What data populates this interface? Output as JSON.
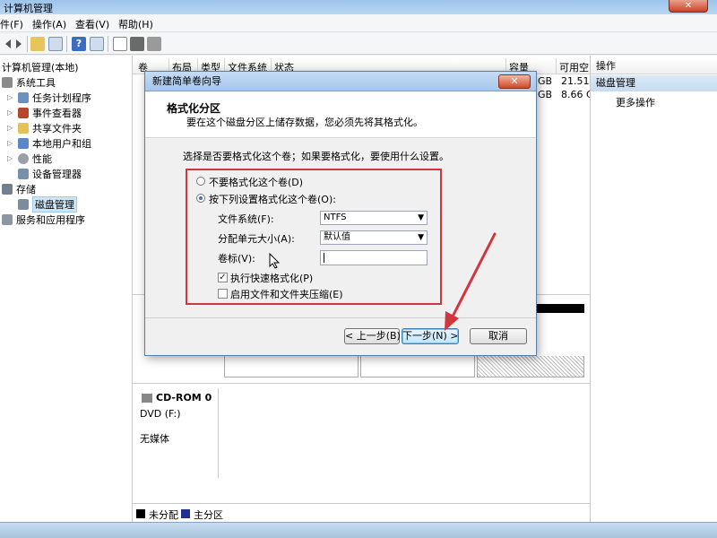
{
  "window": {
    "title": "计算机管理",
    "close_glyph": "✕"
  },
  "menu": [
    "件(F)",
    "操作(A)",
    "查看(V)",
    "帮助(H)"
  ],
  "tree": {
    "root": "计算机管理(本地)",
    "system_tools": "系统工具",
    "task_scheduler": "任务计划程序",
    "event_viewer": "事件查看器",
    "shared_folders": "共享文件夹",
    "local_users": "本地用户和组",
    "performance": "性能",
    "device_manager": "设备管理器",
    "storage": "存储",
    "disk_management": "磁盘管理",
    "services": "服务和应用程序"
  },
  "columns": {
    "volume": "卷",
    "layout": "布局",
    "type": "类型",
    "filesystem": "文件系统",
    "status": "状态",
    "capacity": "容量",
    "free": "可用空"
  },
  "volume_rows": [
    {
      "capacity": "GB",
      "free": "21.51"
    },
    {
      "capacity": "GB",
      "free": "8.66 C"
    }
  ],
  "cdrom": {
    "name": "CD-ROM 0",
    "drive": "DVD (F:)",
    "media": "无媒体"
  },
  "legend": {
    "unallocated": "未分配",
    "primary": "主分区"
  },
  "actions": {
    "header": "操作",
    "section": "磁盘管理",
    "more": "更多操作"
  },
  "dialog": {
    "title": "新建简单卷向导",
    "close": "✕",
    "heading": "格式化分区",
    "subheading": "要在这个磁盘分区上储存数据，您必须先将其格式化。",
    "question": "选择是否要格式化这个卷；如果要格式化，要使用什么设置。",
    "opt_no_format": "不要格式化这个卷(D)",
    "opt_format": "按下列设置格式化这个卷(O):",
    "fs_label": "文件系统(F):",
    "fs_value": "NTFS",
    "alloc_label": "分配单元大小(A):",
    "alloc_value": "默认值",
    "vol_label": "卷标(V):",
    "vol_value": "",
    "quick_format": "执行快速格式化(P)",
    "compress": "启用文件和文件夹压缩(E)",
    "back": "< 上一步(B)",
    "next": "下一步(N) >",
    "cancel": "取消"
  },
  "colors": {
    "accent": "#d1353f",
    "unallocated": "#000000",
    "primary": "#1f2f8f"
  }
}
